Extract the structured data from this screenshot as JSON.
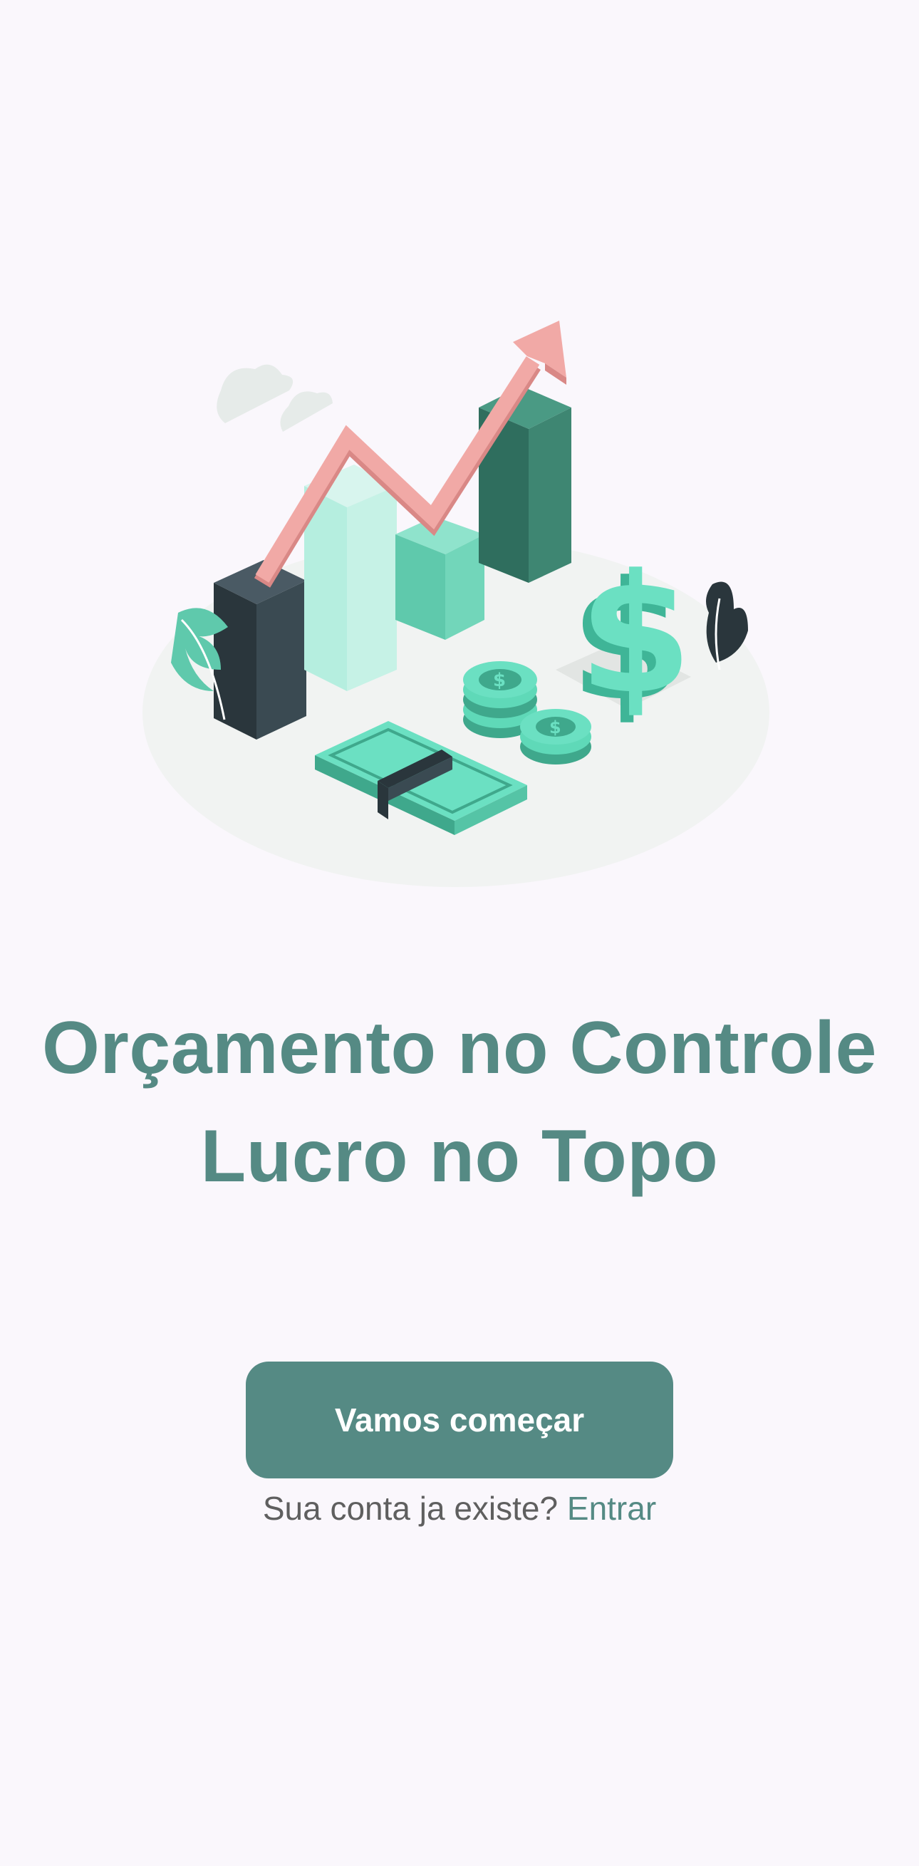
{
  "hero": {
    "illustration": "finance-growth-illustration",
    "title_line1": "Orçamento no Controle",
    "title_line2": "Lucro no Topo"
  },
  "actions": {
    "primary_label": "Vamos começar",
    "signin_prompt": "Sua conta ja existe?",
    "signin_link": "Entrar"
  },
  "colors": {
    "background": "#faf7fc",
    "accent": "#558a84",
    "muted_text": "#5f5f5f",
    "arrow": "#f1a9a6",
    "mint": "#5fd9b8"
  }
}
